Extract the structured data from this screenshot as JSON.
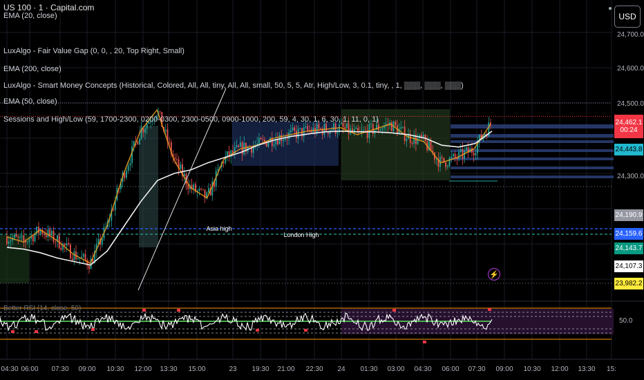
{
  "header": {
    "symbol_title": "US 100 · 1 · Capital.com",
    "currency_button": "USD"
  },
  "indicators": [
    "EMA (20, close)",
    "LuxAlgo - Fair Value Gap (0, 0, , 20, Top Right, Small)",
    "EMA (200, close)",
    "LuxAlgo - Smart Money Concepts (Historical, Colored, All, All, tiny, All, All, small, 50, 5, 5, Atr, High/Low, 3, 0.1, tiny, , 1, ▒▒▒, ▒▒▒, ▒▒▒)",
    "EMA (50, close)",
    "Sessions and High/Low (59, 1700-2300, 0200-0300, 2300-0500, 0900-1000, 200, 59, 4, 30, 1, 6, 30, 1, 11, 0, 1)"
  ],
  "price_axis": {
    "ticks": [
      "24,700.0",
      "24,600.0",
      "24,500.0",
      "24,300.0"
    ],
    "labels": [
      {
        "text": "24,462.1",
        "sub": "00:24",
        "bg": "#f23645",
        "fg": "#ffffff"
      },
      {
        "text": "24,443.8",
        "bg": "#22b8cf",
        "fg": "#000000"
      },
      {
        "text": "24,190.9",
        "bg": "#9598a1",
        "fg": "#ffffff"
      },
      {
        "text": "24,159.6",
        "bg": "#2962ff",
        "fg": "#ffffff"
      },
      {
        "text": "24,143.7",
        "bg": "#089981",
        "fg": "#ffffff"
      },
      {
        "text": "24,107.3",
        "bg": "#ffffff",
        "fg": "#000000"
      },
      {
        "text": "23,982.2",
        "bg": "#ffeb3b",
        "fg": "#000000"
      }
    ]
  },
  "annotations": {
    "asia_high": "Asia high",
    "london_high": "London High"
  },
  "rsi": {
    "label": "Better RSI (14, close, 50)",
    "axis_value": "50.0"
  },
  "time_axis": [
    "04:30",
    "06:00",
    "07:30",
    "09:00",
    "10:30",
    "12:00",
    "13:30",
    "15:00",
    "23",
    "19:30",
    "21:00",
    "22:30",
    "24",
    "01:30",
    "03:00",
    "04:30",
    "06:00",
    "07:30",
    "09:00",
    "10:30",
    "12:00",
    "13:30",
    "15:"
  ],
  "chart_data": {
    "type": "candlestick",
    "title": "US 100 · 1 · Capital.com",
    "x_ticks": [
      "04:30",
      "06:00",
      "07:30",
      "09:00",
      "10:30",
      "12:00",
      "13:30",
      "15:00",
      "23",
      "19:30",
      "21:00",
      "22:30",
      "24",
      "01:30",
      "03:00",
      "04:30",
      "06:00",
      "07:30",
      "09:00",
      "10:30",
      "12:00",
      "13:30",
      "15:"
    ],
    "ylim": [
      23950,
      24760
    ],
    "y_ticks": [
      24700,
      24600,
      24500,
      24300
    ],
    "series": [
      {
        "name": "EMA (20, close)",
        "values": [
          24120,
          24105,
          24140,
          24110,
          24070,
          24045,
          24150,
          24300,
          24420,
          24480,
          24340,
          24260,
          24230,
          24340,
          24370,
          24380,
          24400,
          24410,
          24420,
          24425,
          24430,
          24410,
          24425,
          24440,
          24405,
          24390,
          24330,
          24345,
          24370,
          24440
        ]
      },
      {
        "name": "EMA (200, close)",
        "values": [
          24090,
          24085,
          24075,
          24060,
          24050,
          24040,
          24080,
          24150,
          24220,
          24280,
          24300,
          24310,
          24330,
          24345,
          24360,
          24380,
          24395,
          24405,
          24412,
          24418,
          24420,
          24418,
          24418,
          24415,
          24410,
          24400,
          24380,
          24375,
          24385,
          24420
        ]
      }
    ],
    "price_lines": [
      24462.1,
      24443.8,
      24190.9,
      24159.6,
      24143.7,
      24107.3,
      23982.2
    ],
    "rsi": {
      "name": "Better RSI (14, close, 50)",
      "level": 50
    }
  }
}
